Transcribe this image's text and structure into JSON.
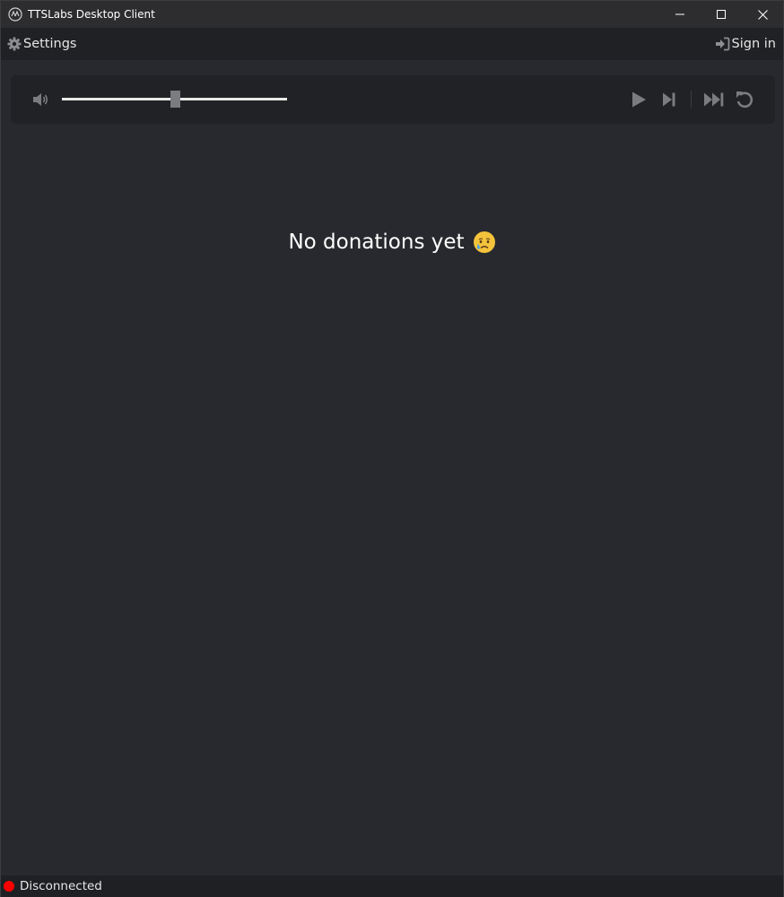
{
  "window": {
    "title": "TTSLabs Desktop Client",
    "icon": "ttslabs-logo-icon",
    "controls": [
      "minimize-icon",
      "maximize-icon",
      "close-icon"
    ]
  },
  "menubar": {
    "settings_label": "Settings",
    "settings_icon": "gear-icon",
    "signin_label": "Sign in",
    "signin_icon": "sign-in-icon"
  },
  "player": {
    "volume_icon": "volume-icon",
    "volume_level": 0.5,
    "buttons": [
      "play-icon",
      "skip-next-icon",
      "fast-forward-icon",
      "replay-icon"
    ]
  },
  "main": {
    "empty_message": "No donations yet",
    "empty_emoji": "sad-tear-emoji"
  },
  "status": {
    "text": "Disconnected",
    "color": "#ff0000"
  },
  "colors": {
    "background": "#28292e",
    "panel": "#212225",
    "icon_muted": "#7b7c80"
  }
}
